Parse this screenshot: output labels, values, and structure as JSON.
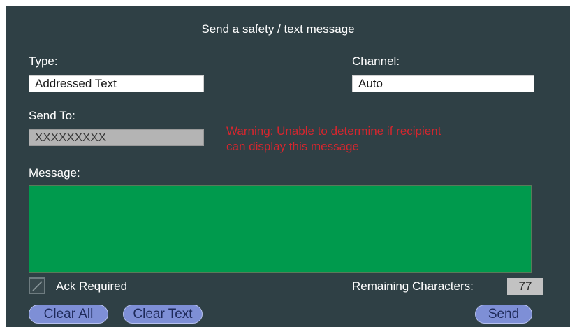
{
  "dialog": {
    "title": "Send a safety / text message"
  },
  "type": {
    "label": "Type:",
    "value": "Addressed Text"
  },
  "channel": {
    "label": "Channel:",
    "value": "Auto"
  },
  "send_to": {
    "label": "Send To:",
    "value": "XXXXXXXXX"
  },
  "warning": {
    "line1": "Warning: Unable to determine if recipient",
    "line2": "can display this message",
    "color": "#d6262e"
  },
  "message": {
    "label": "Message:",
    "value": "",
    "background": "#009a4d"
  },
  "ack": {
    "label": "Ack Required",
    "checked": true
  },
  "remaining": {
    "label": "Remaining Characters:",
    "value": "77"
  },
  "buttons": {
    "clear_all": "Clear All",
    "clear_text": "Clear Text",
    "send": "Send"
  },
  "colors": {
    "panel": "#2f4045",
    "button": "#7e8fd6"
  }
}
